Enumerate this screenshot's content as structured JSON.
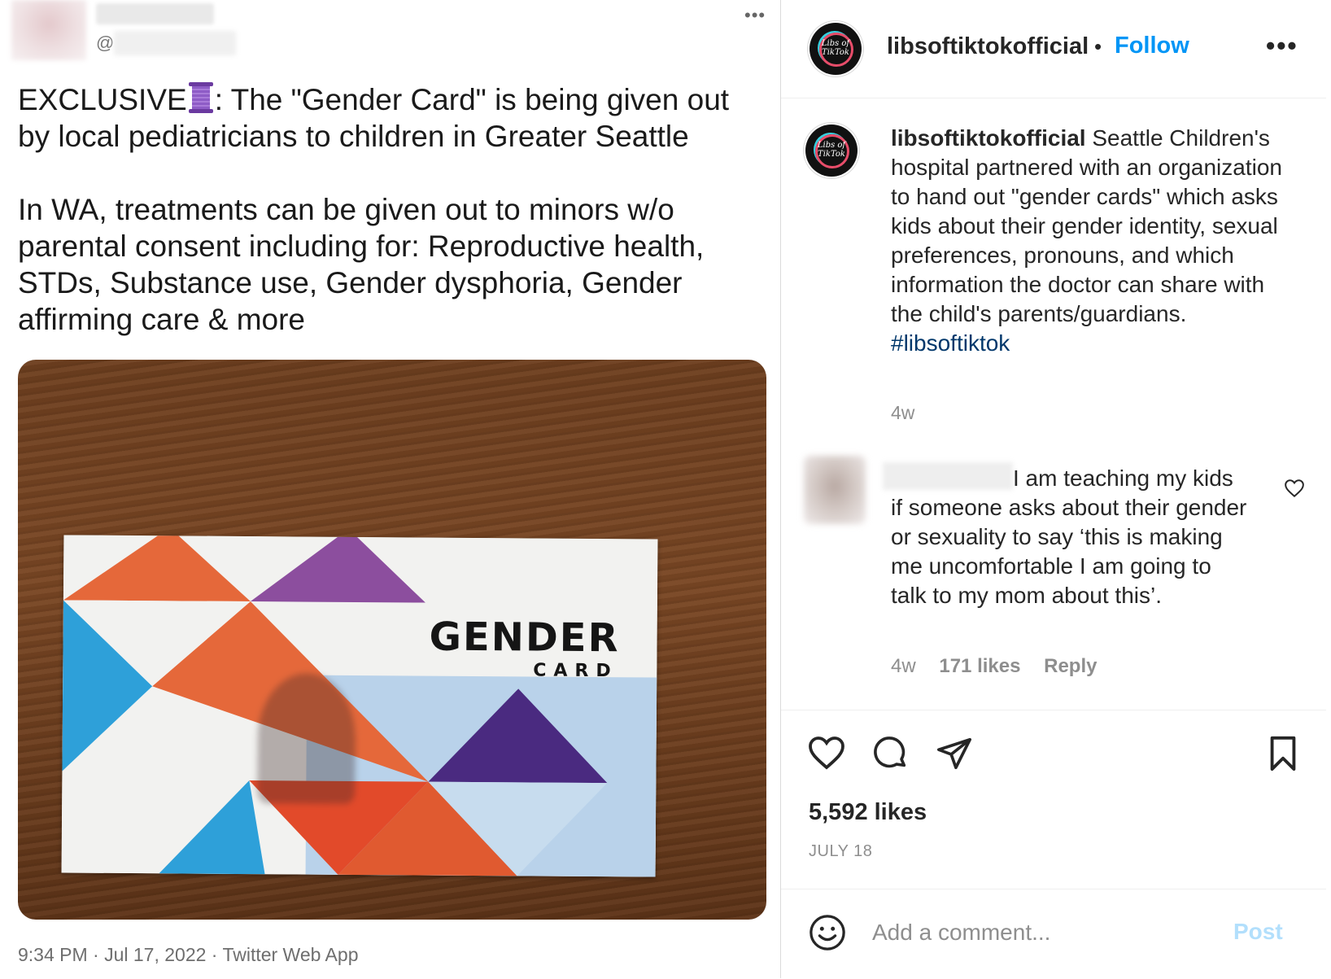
{
  "tweet": {
    "handle_prefix": "@",
    "more_label": "•••",
    "text_line1_a": "EXCLUSIVE",
    "text_line1_b": ": The \"Gender Card\" is being given out by local pediatricians to children in Greater Seattle",
    "text_para2": "In WA, treatments can be given out to minors w/o parental consent including for: Reproductive health, STDs, Substance use, Gender dysphoria, Gender affirming care & more",
    "photo": {
      "card_title": "GENDER",
      "card_subtitle": "CARD"
    },
    "footer": "9:34 PM · Jul 17, 2022 · Twitter Web App"
  },
  "instagram": {
    "header": {
      "logo_text": "Libs of TikTok",
      "username": "libsoftiktokofficial",
      "separator": "•",
      "follow_label": "Follow",
      "more_label": "•••"
    },
    "caption": {
      "username": "libsoftiktokofficial",
      "text": "Seattle Children's hospital partnered with an organization to hand out \"gender cards\" which asks kids about their gender identity, sexual preferences, pronouns, and which information the doctor can share with the child's parents/guardians.",
      "hashtag": "#libsoftiktok",
      "time": "4w"
    },
    "comment": {
      "text": "I am teaching my kids if someone asks about their gender or sexuality to say ‘this is making me uncomfortable I am going to talk to my mom about this’.",
      "time": "4w",
      "likes": "171 likes",
      "reply_label": "Reply"
    },
    "actions": {
      "likes": "5,592 likes",
      "date": "JULY 18"
    },
    "add_comment": {
      "placeholder": "Add a comment...",
      "post_label": "Post"
    }
  },
  "colors": {
    "accent": "#0095f6",
    "hashtag": "#00376b",
    "muted": "#8e8e8e",
    "post_disabled": "#b2dffc"
  }
}
